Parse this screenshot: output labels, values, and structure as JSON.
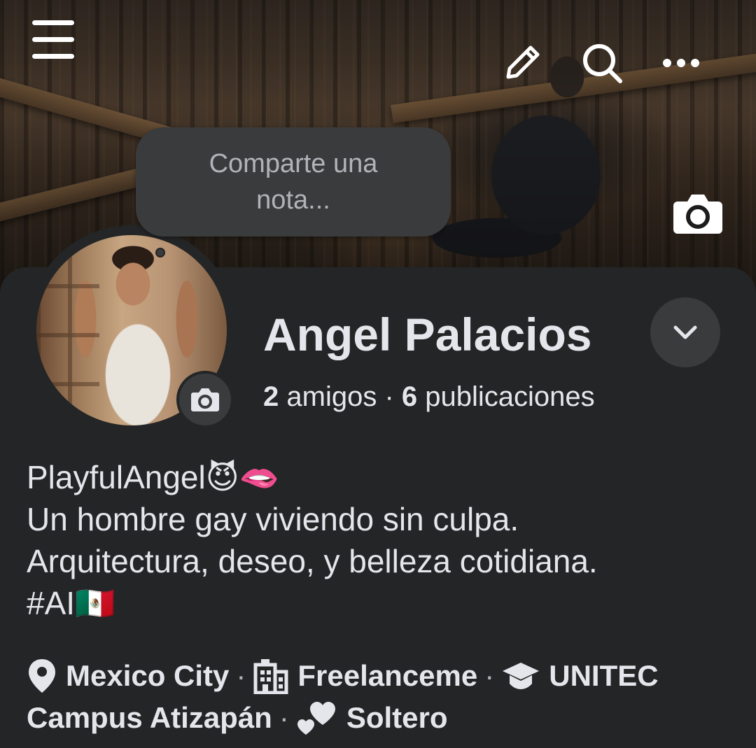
{
  "header": {
    "menu_icon": "menu-icon",
    "edit_icon": "pencil-icon",
    "search_icon": "search-icon",
    "more_icon": "more-icon",
    "cover_camera_icon": "camera-icon"
  },
  "note": {
    "placeholder": "Comparte una nota..."
  },
  "profile": {
    "name": "Angel Palacios",
    "friends_count": "2",
    "friends_label": "amigos",
    "separator": "·",
    "posts_count": "6",
    "posts_label": "publicaciones",
    "avatar_camera_icon": "camera-icon",
    "options_icon": "chevron-down-icon"
  },
  "bio": {
    "lines": [
      "PlayfulAngel😈🫦",
      "Un hombre gay viviendo sin culpa.",
      "Arquitectura, deseo, y belleza cotidiana.",
      "#AI🇲🇽"
    ]
  },
  "details": {
    "location": "Mexico City",
    "work": "Freelanceme",
    "education": "UNITEC",
    "education_continued": "Campus Atizapán",
    "relationship": "Soltero",
    "separator": "·",
    "icons": [
      "location-pin-icon",
      "building-icon",
      "graduation-cap-icon",
      "hearts-icon"
    ]
  },
  "colors": {
    "background": "#242526",
    "surface": "#3a3b3c",
    "text_primary": "#e4e6eb",
    "text_secondary": "#b0b3b8"
  }
}
